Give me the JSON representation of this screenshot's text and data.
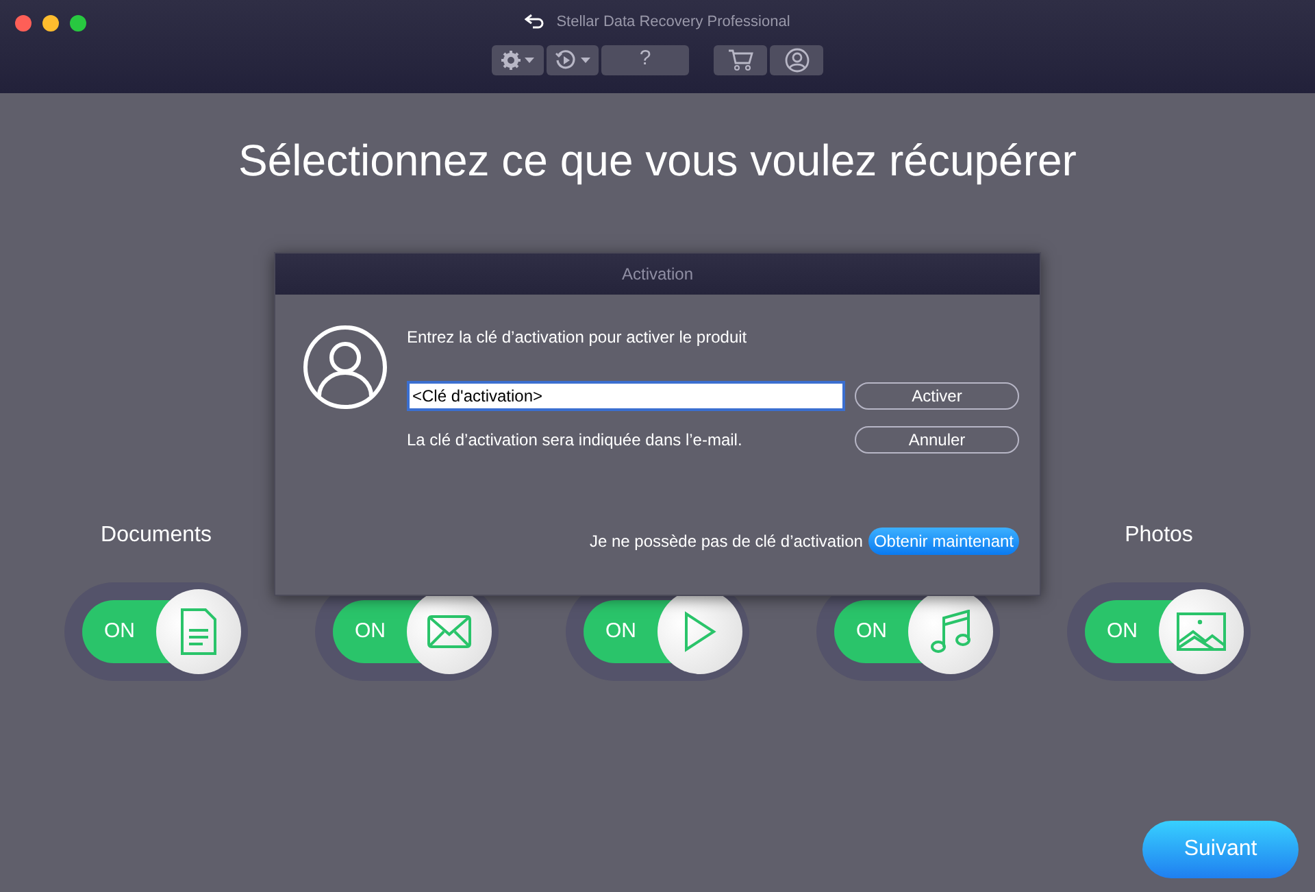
{
  "window": {
    "title": "Stellar Data Recovery Professional"
  },
  "toolbar": [
    {
      "kind": "gear",
      "dropdown": true
    },
    {
      "kind": "history",
      "dropdown": true
    },
    {
      "kind": "help",
      "text": "?"
    },
    {
      "kind": "cart"
    },
    {
      "kind": "account"
    }
  ],
  "heading": "Sélectionnez ce que vous voulez récupérer",
  "categories": [
    {
      "label": "Documents",
      "kind": "document",
      "on": true,
      "state_text": "ON"
    },
    {
      "kind": "mail",
      "on": true,
      "state_text": "ON"
    },
    {
      "kind": "video",
      "on": true,
      "state_text": "ON"
    },
    {
      "kind": "audio",
      "on": true,
      "state_text": "ON"
    },
    {
      "label": "Photos",
      "kind": "photo",
      "on": true,
      "state_text": "ON"
    }
  ],
  "dialog": {
    "title": "Activation",
    "prompt": "Entrez la clé d’activation pour activer le produit",
    "key_field": {
      "value": "<Clé d'activation>"
    },
    "hint": "La clé d’activation sera indiquée dans l’e-mail.",
    "buttons": [
      "Activer",
      "Annuler"
    ],
    "no_key_text": "Je ne possède pas de clé d’activation",
    "get_now": "Obtenir maintenant"
  },
  "next_button": "Suivant"
}
